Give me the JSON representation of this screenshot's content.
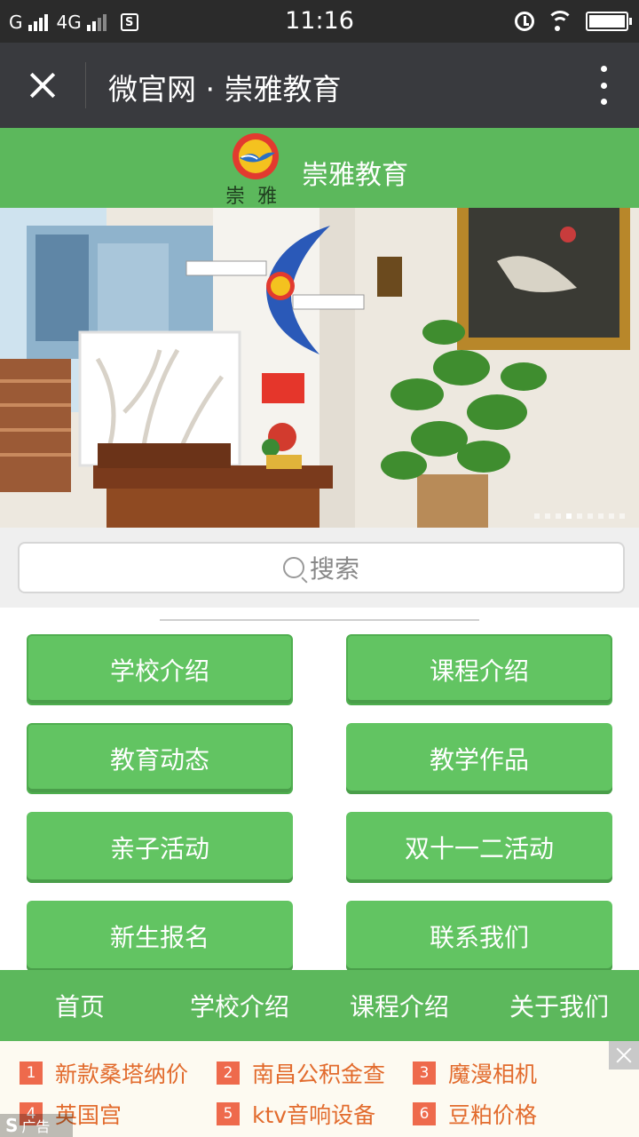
{
  "status_bar": {
    "carrier": "G",
    "network": "4G",
    "time": "11:16"
  },
  "nav": {
    "title": "微官网 · 崇雅教育"
  },
  "header": {
    "logo_text": "崇雅",
    "site_name": "崇雅教育"
  },
  "banner": {
    "slide_count": 9,
    "active_slide": 4
  },
  "search": {
    "placeholder": "搜索"
  },
  "menu": {
    "items": [
      {
        "label": "学校介绍"
      },
      {
        "label": "课程介绍"
      },
      {
        "label": "教育动态"
      },
      {
        "label": "教学作品"
      },
      {
        "label": "亲子活动"
      },
      {
        "label": "双十一二活动"
      },
      {
        "label": "新生报名"
      },
      {
        "label": "联系我们"
      }
    ]
  },
  "bottom_nav": {
    "items": [
      {
        "label": "首页"
      },
      {
        "label": "学校介绍"
      },
      {
        "label": "课程介绍"
      },
      {
        "label": "关于我们"
      }
    ]
  },
  "ad": {
    "items": [
      {
        "num": "1",
        "text": "新款桑塔纳价"
      },
      {
        "num": "2",
        "text": "南昌公积金查"
      },
      {
        "num": "3",
        "text": "魔漫相机"
      },
      {
        "num": "4",
        "text": "英国宫"
      },
      {
        "num": "5",
        "text": "ktv音响设备"
      },
      {
        "num": "6",
        "text": "豆粕价格"
      }
    ],
    "label_logo": "S",
    "label": "广告"
  },
  "colors": {
    "brand_green": "#5cb85c",
    "button_green": "#62c462",
    "nav_dark": "#393a3e",
    "ad_orange": "#e26b2d"
  }
}
